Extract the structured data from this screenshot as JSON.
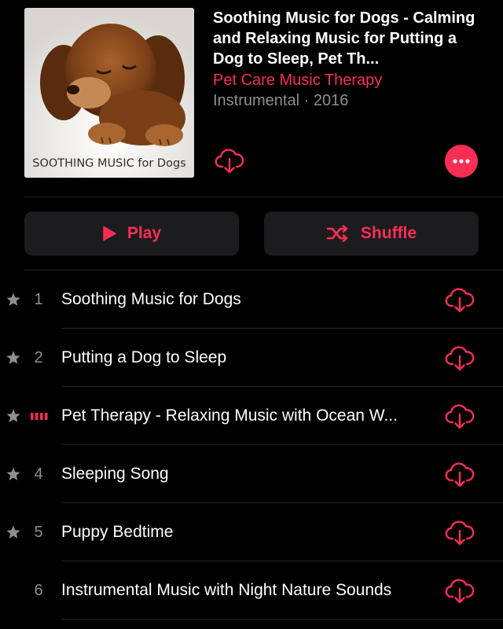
{
  "album": {
    "title": "Soothing Music for Dogs - Calming and Relaxing Music for Putting a Dog to Sleep, Pet Th...",
    "artist": "Pet Care Music Therapy",
    "meta": "Instrumental · 2016",
    "art_caption": "SOOTHING MUSIC for Dogs",
    "download_icon": "cloud-download-icon",
    "more_icon": "ellipsis-icon"
  },
  "actions": {
    "play_label": "Play",
    "shuffle_label": "Shuffle"
  },
  "colors": {
    "accent": "#fa2d55",
    "secondary_text": "#8e8e93",
    "button_bg": "#1c1c1e",
    "background": "#000000"
  },
  "tracks": [
    {
      "number": "1",
      "title": "Soothing Music for Dogs",
      "starred": true,
      "playing": false
    },
    {
      "number": "2",
      "title": "Putting a Dog to Sleep",
      "starred": true,
      "playing": false
    },
    {
      "number": "3",
      "title": "Pet Therapy - Relaxing Music with Ocean W...",
      "starred": true,
      "playing": true
    },
    {
      "number": "4",
      "title": "Sleeping Song",
      "starred": true,
      "playing": false
    },
    {
      "number": "5",
      "title": "Puppy Bedtime",
      "starred": true,
      "playing": false
    },
    {
      "number": "6",
      "title": "Instrumental Music with Night Nature Sounds",
      "starred": false,
      "playing": false
    }
  ]
}
